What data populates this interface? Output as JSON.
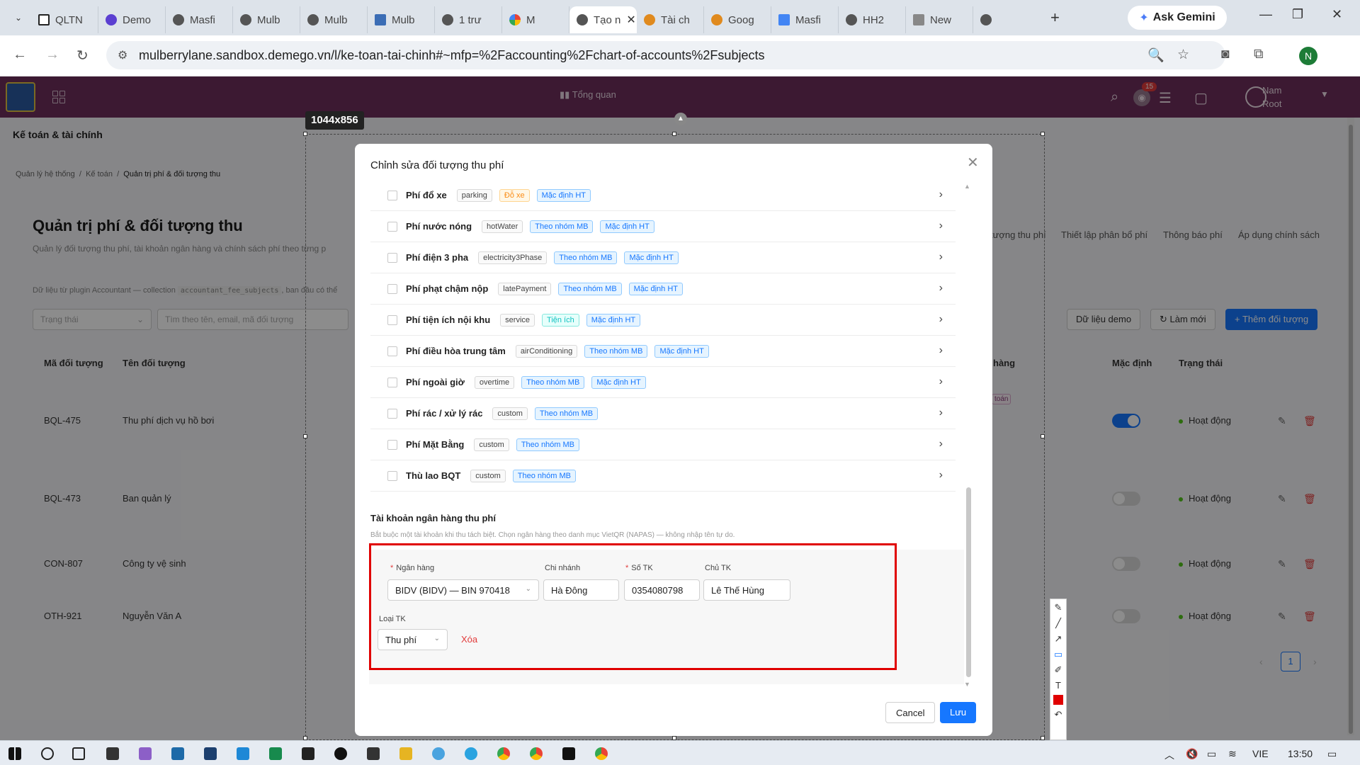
{
  "browser": {
    "tabs": [
      "QLTN",
      "Demo",
      "Masfi",
      "Mulb",
      "Mulb",
      "Mulb",
      "1 trư",
      "M",
      "Tạo n",
      "Tài ch",
      "Goog",
      "Masfi",
      "HH2",
      "New"
    ],
    "active_tab": 7,
    "ask_gemini": "Ask Gemini",
    "url": "mulberrylane.sandbox.demego.vn/l/ke-toan-tai-chinh#~mfp=%2Faccounting%2Fchart-of-accounts%2Fsubjects",
    "profile": "N"
  },
  "app": {
    "overview": "Tổng quan",
    "notif_count": "15",
    "user_name": "Nam",
    "user_role": "Root",
    "section": "Kế toán & tài chính",
    "breadcrumb": [
      "Quản lý hệ thống",
      "Kế toán",
      "Quản trị phí & đối tượng thu"
    ],
    "title": "Quản trị phí & đối tượng thu",
    "subtitle": "Quản lý đối tượng thu phí, tài khoản ngân hàng và chính sách phí theo từng p",
    "note_prefix": "Dữ liệu từ plugin Accountant — collection",
    "note_code": "accountant_fee_subjects",
    "note_suffix": ", ban đầu có thể",
    "filter_status": "Trạng thái",
    "filter_search": "Tìm theo tên, email, mã đối tượng",
    "right_tabs": [
      "tượng thu phí",
      "Thiết lập phân bổ phí",
      "Thông báo phí",
      "Áp dụng chính sách"
    ],
    "btn_demo": "Dữ liệu demo",
    "btn_refresh": "Làm mới",
    "btn_add": "Thêm đối tượng",
    "columns": {
      "code": "Mã đối tượng",
      "name": "Tên đối tượng",
      "bank": "hàng",
      "default": "Mặc định",
      "status": "Trạng thái"
    },
    "rows": [
      {
        "code": "BQL-475",
        "name": "Thu phí dịch vụ hồ bơi",
        "default": true,
        "status": "Hoạt động"
      },
      {
        "code": "BQL-473",
        "name": "Ban quản lý",
        "default": false,
        "status": "Hoạt động"
      },
      {
        "code": "CON-807",
        "name": "Công ty vệ sinh",
        "default": false,
        "status": "Hoạt động"
      },
      {
        "code": "OTH-921",
        "name": "Nguyễn Văn A",
        "default": false,
        "status": "Hoạt động"
      }
    ],
    "row_badge": "toán",
    "page": "1"
  },
  "modal": {
    "title": "Chỉnh sửa đối tượng thu phí",
    "fees": [
      {
        "name": "Phí đổ xe",
        "code": "parking",
        "tags": [
          {
            "t": "Đỗ xe",
            "c": "orange"
          },
          {
            "t": "Mặc định HT",
            "c": "blue"
          }
        ]
      },
      {
        "name": "Phí nước nóng",
        "code": "hotWater",
        "tags": [
          {
            "t": "Theo nhóm MB",
            "c": "blue"
          },
          {
            "t": "Mặc định HT",
            "c": "blue"
          }
        ]
      },
      {
        "name": "Phí điện 3 pha",
        "code": "electricity3Phase",
        "tags": [
          {
            "t": "Theo nhóm MB",
            "c": "blue"
          },
          {
            "t": "Mặc định HT",
            "c": "blue"
          }
        ]
      },
      {
        "name": "Phí phạt chậm nộp",
        "code": "latePayment",
        "tags": [
          {
            "t": "Theo nhóm MB",
            "c": "blue"
          },
          {
            "t": "Mặc định HT",
            "c": "blue"
          }
        ]
      },
      {
        "name": "Phí tiện ích nội khu",
        "code": "service",
        "tags": [
          {
            "t": "Tiện ích",
            "c": "cyan"
          },
          {
            "t": "Mặc định HT",
            "c": "blue"
          }
        ]
      },
      {
        "name": "Phí điều hòa trung tâm",
        "code": "airConditioning",
        "tags": [
          {
            "t": "Theo nhóm MB",
            "c": "blue"
          },
          {
            "t": "Mặc định HT",
            "c": "blue"
          }
        ]
      },
      {
        "name": "Phí ngoài giờ",
        "code": "overtime",
        "tags": [
          {
            "t": "Theo nhóm MB",
            "c": "blue"
          },
          {
            "t": "Mặc định HT",
            "c": "blue"
          }
        ]
      },
      {
        "name": "Phí rác / xử lý rác",
        "code": "custom",
        "tags": [
          {
            "t": "Theo nhóm MB",
            "c": "blue"
          }
        ]
      },
      {
        "name": "Phí Mặt Bằng",
        "code": "custom",
        "tags": [
          {
            "t": "Theo nhóm MB",
            "c": "blue"
          }
        ]
      },
      {
        "name": "Thù lao BQT",
        "code": "custom",
        "tags": [
          {
            "t": "Theo nhóm MB",
            "c": "blue"
          }
        ]
      }
    ],
    "bank_section": "Tài khoản ngân hàng thu phí",
    "bank_note": "Bắt buộc một tài khoản khi thu tách biệt. Chọn ngân hàng theo danh mục VietQR (NAPAS) — không nhập tên tự do.",
    "label_bank": "Ngân hàng",
    "label_branch": "Chi nhánh",
    "label_account": "Số TK",
    "label_owner": "Chủ TK",
    "label_type": "Loại TK",
    "bank": "BIDV (BIDV) — BIN 970418",
    "branch": "Hà Đông",
    "account": "0354080798",
    "owner": "Lê Thế Hùng",
    "type": "Thu phí",
    "delete": "Xóa",
    "cancel": "Cancel",
    "save": "Lưu"
  },
  "snip": {
    "size": "1044x856"
  },
  "taskbar": {
    "lang": "VIE",
    "time": "13:50"
  }
}
